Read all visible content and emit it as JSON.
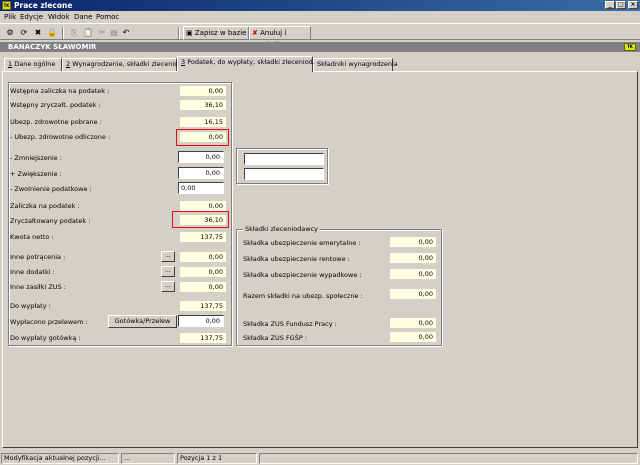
{
  "window": {
    "title": "Prace zlecone",
    "app_icon": "tk-icon"
  },
  "menu": [
    "Plik",
    "Edycje",
    "Widok",
    "Dane",
    "Pomoc"
  ],
  "toolbar": {
    "save_label": "Zapisz w bazie",
    "cancel_label": "Anuluj i zamknij"
  },
  "person_name": "BANACZYK SŁAWOMIR",
  "tabs": [
    {
      "num": "1",
      "label": " Dane ogólne"
    },
    {
      "num": "2",
      "label": " Wynagrodzenie, składki zleceniob."
    },
    {
      "num": "3",
      "label": " Podatek, do wypłaty, składki zleceniod."
    },
    {
      "num": "",
      "label": "Składniki wynagrodzenia"
    }
  ],
  "left": {
    "wstepna_zaliczka": {
      "label": "Wstępna zaliczka na podatek :",
      "value": "0,00"
    },
    "wstepny_zrycz": {
      "label": "Wstępny zryczałt. podatek :",
      "value": "36,10"
    },
    "ubezp_pobrane": {
      "label": "Ubezp. zdrowotne pobrane :",
      "value": "16,15"
    },
    "ubezp_odliczone": {
      "label": "- Ubezp. zdrowotne odliczone :",
      "value": "0,00"
    },
    "zmniejszenie": {
      "label": "- Zmniejszenie :",
      "value": "0,00"
    },
    "zwiekszenie": {
      "label": "+ Zwiększenie :",
      "value": "0,00"
    },
    "zwolnienie": {
      "label": "- Zwolnienie podatkowe :",
      "value": "0,00"
    },
    "zaliczka": {
      "label": "Zaliczka na podatek :",
      "value": "0,00"
    },
    "zrycz_podatek": {
      "label": "Zryczałtowany podatek :",
      "value": "36,10"
    },
    "kwota_netto": {
      "label": "Kwota netto :",
      "value": "137,75"
    },
    "inne_potracenia": {
      "label": "Inne potrącenia :",
      "value": "0,00",
      "btn": "..."
    },
    "inne_dodatki": {
      "label": "Inne dodatki :",
      "value": "0,00",
      "btn": "..."
    },
    "inne_zasilki": {
      "label": "Inne zasiłki ZUS :",
      "value": "0,00",
      "btn": "..."
    },
    "do_wyplaty": {
      "label": "Do wypłaty :",
      "value": "137,75"
    },
    "wyplacono_przelewem": {
      "label": "Wypłacono przelewem :",
      "value": "0,00",
      "btn": "Gotówka/Przelew"
    },
    "do_wyplaty_gotowka": {
      "label": "Do wypłaty gotówką :",
      "value": "137,75"
    }
  },
  "skladki": {
    "title": "Składki zleceniodawcy",
    "emerytalne": {
      "label": "Składka ubezpieczenie emerytalne :",
      "value": "0,00"
    },
    "rentowe": {
      "label": "Składka ubezpieczenie rentowe :",
      "value": "0,00"
    },
    "wypadkowe": {
      "label": "Składka ubezpieczenie wypadkowe :",
      "value": "0,00"
    },
    "razem": {
      "label": "Razem składki na ubezp. społeczne :",
      "value": "0,00"
    },
    "fp": {
      "label": "Składka ZUS Fundusz Pracy :",
      "value": "0,00"
    },
    "fgsp": {
      "label": "Składka ZUS FGŚP :",
      "value": "0,00"
    }
  },
  "status": {
    "message": "Modyfikacja aktualnej pozycji...",
    "ellipsis": "...",
    "position": "Pozycja 1 z 1"
  }
}
